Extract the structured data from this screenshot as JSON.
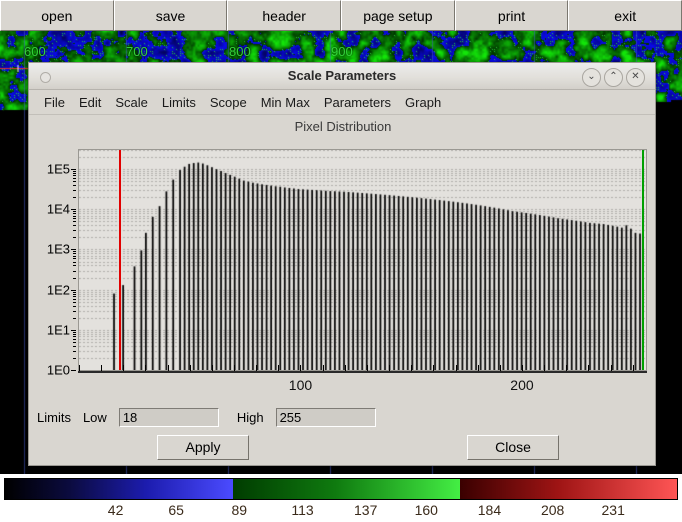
{
  "toolbar": {
    "buttons": [
      {
        "label": "open",
        "name": "toolbar-open-button"
      },
      {
        "label": "save",
        "name": "toolbar-save-button"
      },
      {
        "label": "header",
        "name": "toolbar-header-button"
      },
      {
        "label": "page setup",
        "name": "toolbar-page-setup-button"
      },
      {
        "label": "print",
        "name": "toolbar-print-button"
      },
      {
        "label": "exit",
        "name": "toolbar-exit-button"
      }
    ]
  },
  "background_image": {
    "description": "false-color raster image (blue/green/red colormap)",
    "axis_labels": [
      "600",
      "700",
      "800",
      "900"
    ]
  },
  "dialog": {
    "title": "Scale Parameters",
    "title_buttons": {
      "minimize": "⌄",
      "maximize": "⌃",
      "close": "✕"
    },
    "menu": [
      "File",
      "Edit",
      "Scale",
      "Limits",
      "Scope",
      "Min Max",
      "Parameters",
      "Graph"
    ],
    "chart_title": "Pixel Distribution",
    "limits": {
      "group_label": "Limits",
      "low_label": "Low",
      "low_value": "18",
      "high_label": "High",
      "high_value": "255"
    },
    "buttons": {
      "apply": "Apply",
      "close": "Close"
    }
  },
  "colorbar": {
    "labels": [
      "42",
      "65",
      "89",
      "113",
      "137",
      "160",
      "184",
      "208",
      "231"
    ],
    "label_positions": [
      155,
      310,
      465,
      622,
      777,
      932,
      1090,
      1245,
      1400
    ],
    "segments": [
      {
        "name": "blue",
        "from": "#000000",
        "to": "#4b4bff"
      },
      {
        "name": "green",
        "from": "#003c00",
        "to": "#44ee44"
      },
      {
        "name": "red",
        "from": "#3a0000",
        "to": "#ff5555"
      }
    ]
  },
  "chart_data": {
    "type": "bar",
    "title": "Pixel Distribution",
    "xlabel": "",
    "ylabel": "",
    "xlim": [
      0,
      255
    ],
    "ylim": [
      1,
      300000
    ],
    "yscale": "log",
    "grid": true,
    "legend": false,
    "y_ticks": [
      1,
      10,
      100,
      1000,
      10000,
      100000
    ],
    "y_tick_labels": [
      "1E0",
      "1E1",
      "1E2",
      "1E3",
      "1E4",
      "1E5"
    ],
    "x_ticks": [
      100,
      200
    ],
    "x_tick_labels": [
      "100",
      "200"
    ],
    "markers": [
      {
        "name": "low-limit",
        "x": 18,
        "color": "#e10000"
      },
      {
        "name": "high-limit",
        "x": 255,
        "color": "#00a000"
      }
    ],
    "bar_color": "#000000",
    "categories": [
      0,
      1,
      2,
      3,
      4,
      5,
      6,
      7,
      8,
      9,
      10,
      11,
      12,
      13,
      14,
      15,
      16,
      17,
      18,
      19,
      20,
      21,
      22,
      23,
      24,
      25,
      26,
      27,
      28,
      29,
      30,
      31,
      32,
      33,
      34,
      35,
      36,
      37,
      38,
      39,
      40,
      41,
      42,
      43,
      44,
      45,
      46,
      47,
      48,
      49,
      50,
      51,
      52,
      53,
      54,
      55,
      56,
      57,
      58,
      59,
      60,
      61,
      62,
      63,
      64,
      65,
      66,
      67,
      68,
      69,
      70,
      71,
      72,
      73,
      74,
      75,
      76,
      77,
      78,
      79,
      80,
      81,
      82,
      83,
      84,
      85,
      86,
      87,
      88,
      89,
      90,
      91,
      92,
      93,
      94,
      95,
      96,
      97,
      98,
      99,
      100,
      101,
      102,
      103,
      104,
      105,
      106,
      107,
      108,
      109,
      110,
      111,
      112,
      113,
      114,
      115,
      116,
      117,
      118,
      119,
      120,
      121,
      122,
      123,
      124,
      125,
      126,
      127,
      128,
      129,
      130,
      131,
      132,
      133,
      134,
      135,
      136,
      137,
      138,
      139,
      140,
      141,
      142,
      143,
      144,
      145,
      146,
      147,
      148,
      149,
      150,
      151,
      152,
      153,
      154,
      155,
      156,
      157,
      158,
      159,
      160,
      161,
      162,
      163,
      164,
      165,
      166,
      167,
      168,
      169,
      170,
      171,
      172,
      173,
      174,
      175,
      176,
      177,
      178,
      179,
      180,
      181,
      182,
      183,
      184,
      185,
      186,
      187,
      188,
      189,
      190,
      191,
      192,
      193,
      194,
      195,
      196,
      197,
      198,
      199,
      200,
      201,
      202,
      203,
      204,
      205,
      206,
      207,
      208,
      209,
      210,
      211,
      212,
      213,
      214,
      215,
      216,
      217,
      218,
      219,
      220,
      221,
      222,
      223,
      224,
      225,
      226,
      227,
      228,
      229,
      230,
      231,
      232,
      233,
      234,
      235,
      236,
      237,
      238,
      239,
      240,
      241,
      242,
      243,
      244,
      245,
      246,
      247,
      248,
      249,
      250,
      251,
      252,
      253,
      254,
      255
    ],
    "values": [
      1,
      1,
      1,
      1,
      1,
      1,
      1,
      1,
      1,
      1,
      1,
      1,
      1,
      1,
      1,
      80,
      1,
      1,
      1,
      130,
      1,
      1,
      1,
      1,
      380,
      1,
      1,
      950,
      1,
      2600,
      1,
      1,
      6500,
      1,
      1,
      12000,
      1,
      1,
      28000,
      1,
      1,
      55000,
      1,
      1,
      95000,
      1,
      115000,
      1,
      135000,
      1,
      142000,
      1,
      146000,
      1,
      138000,
      1,
      125000,
      1,
      112000,
      1,
      100000,
      1,
      90000,
      1,
      80000,
      1,
      72000,
      1,
      65000,
      1,
      58000,
      1,
      52000,
      1,
      49000,
      1,
      46000,
      1,
      44000,
      1,
      42000,
      1,
      40500,
      1,
      39000,
      1,
      37500,
      1,
      36500,
      1,
      35000,
      1,
      34000,
      1,
      33000,
      1,
      32000,
      1,
      31500,
      1,
      31000,
      1,
      30500,
      1,
      30000,
      1,
      29500,
      1,
      29000,
      1,
      28500,
      1,
      28200,
      1,
      27800,
      1,
      27500,
      1,
      27000,
      1,
      26500,
      1,
      26000,
      1,
      25500,
      1,
      25000,
      1,
      24500,
      1,
      24000,
      1,
      23500,
      1,
      23000,
      1,
      22500,
      1,
      22000,
      1,
      21500,
      1,
      21000,
      1,
      20500,
      1,
      20000,
      1,
      19500,
      1,
      19000,
      1,
      18500,
      1,
      18000,
      1,
      17500,
      1,
      17000,
      1,
      16500,
      1,
      16000,
      1,
      15500,
      1,
      15000,
      1,
      14500,
      1,
      14000,
      1,
      13500,
      1,
      13000,
      1,
      12500,
      1,
      12000,
      1,
      11500,
      1,
      11000,
      1,
      10500,
      1,
      10000,
      1,
      9500,
      1,
      9000,
      1,
      8700,
      1,
      8400,
      1,
      8100,
      1,
      7800,
      1,
      7500,
      1,
      7200,
      1,
      6900,
      1,
      6600,
      1,
      6300,
      1,
      6000,
      1,
      5800,
      1,
      5600,
      1,
      5400,
      1,
      5200,
      1,
      5000,
      1,
      4800,
      1,
      4600,
      1,
      4500,
      1,
      4400,
      1,
      4300,
      1,
      4100,
      1,
      3900,
      1,
      3700,
      1,
      3500,
      1,
      4000,
      1,
      3300,
      1,
      2600,
      1,
      2500,
      1,
      1
    ]
  }
}
